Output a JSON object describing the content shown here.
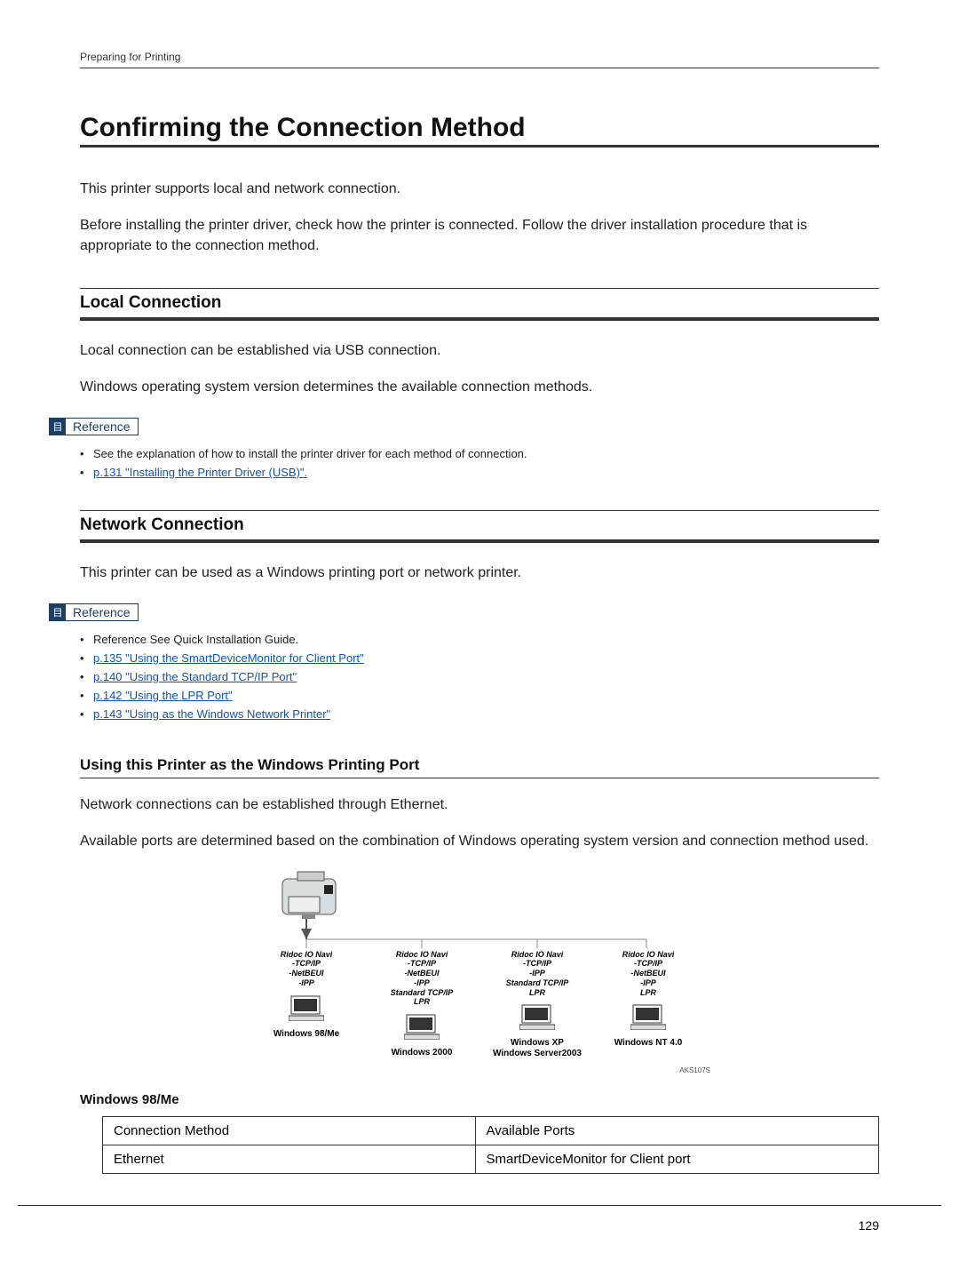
{
  "header": "Preparing for Printing",
  "title": "Confirming the Connection Method",
  "intro1": "This printer supports local and network connection.",
  "intro2": "Before installing the printer driver, check how the printer is connected. Follow the driver installation procedure that is appropriate to the connection method.",
  "local": {
    "heading": "Local Connection",
    "p1": "Local connection can be established via USB connection.",
    "p2": "Windows operating system version determines the available connection methods.",
    "reference_label": "Reference",
    "refs": {
      "item1": "See the explanation of how to install the printer driver for each method of connection.",
      "link1": "p.131 \"Installing the Printer Driver (USB)\"."
    }
  },
  "network": {
    "heading": "Network Connection",
    "p1": "This printer can be used as a Windows printing port or network printer.",
    "reference_label": "Reference",
    "refs": {
      "item1": "Reference See Quick Installation Guide.",
      "link1": "p.135 \"Using the SmartDeviceMonitor for Client Port\"",
      "link2": "p.140 \"Using the Standard TCP/IP Port\"",
      "link3": "p.142 \"Using the LPR Port\"",
      "link4": "p.143 \"Using as the Windows Network Printer\""
    },
    "sub": {
      "heading": "Using this Printer as the Windows Printing Port",
      "p1": "Network connections can be established through Ethernet.",
      "p2": "Available ports are determined based on the combination of Windows operating system version and connection method used."
    }
  },
  "diagram": {
    "os1": {
      "protocols": "Ridoc IO Navi\n-TCP/IP\n-NetBEUI\n-IPP",
      "name": "Windows  98/Me"
    },
    "os2": {
      "protocols": "Ridoc IO Navi\n-TCP/IP\n-NetBEUI\n-IPP\nStandard TCP/IP\nLPR",
      "name": "Windows 2000"
    },
    "os3": {
      "protocols": "Ridoc IO Navi\n-TCP/IP\n-IPP\nStandard TCP/IP\nLPR",
      "name": "Windows XP\nWindows Server2003"
    },
    "os4": {
      "protocols": "Ridoc IO Navi\n-TCP/IP\n-NetBEUI\n-IPP\nLPR",
      "name": "Windows NT 4.0"
    },
    "code": "AKS107S"
  },
  "table": {
    "os_heading": "Windows 98/Me",
    "h1": "Connection Method",
    "h2": "Available Ports",
    "r1c1": "Ethernet",
    "r1c2": "SmartDeviceMonitor for Client port"
  },
  "page_number": "129"
}
